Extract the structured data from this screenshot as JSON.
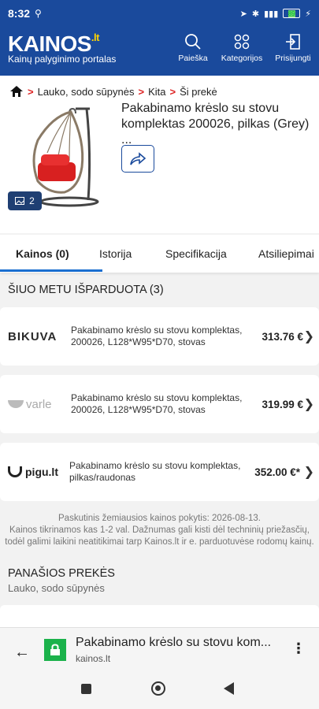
{
  "status": {
    "time": "8:32",
    "battery": "89"
  },
  "header": {
    "logo": "KAINOS",
    "logo_tld": ".lt",
    "tagline": "Kainų palyginimo portalas",
    "nav": [
      {
        "label": "Paieška",
        "icon": "search-icon"
      },
      {
        "label": "Kategorijos",
        "icon": "grid-icon"
      },
      {
        "label": "Prisijungti",
        "icon": "login-icon"
      }
    ]
  },
  "breadcrumb": [
    "Lauko, sodo sūpynės",
    "Kita",
    "Ši prekė"
  ],
  "product": {
    "title": "Pakabinamo krėslo su stovu komplektas 200026, pilkas (Grey) ...",
    "image_count": "2"
  },
  "tabs": [
    "Kainos (0)",
    "Istorija",
    "Specifikacija",
    "Atsiliepimai"
  ],
  "sold_out": {
    "title": "ŠIUO METU IŠPARDUOTA (3)",
    "offers": [
      {
        "shop": "BIKUVA",
        "desc": "Pakabinamo krėslo su stovu komplektas, 200026, L128*W95*D70, stovas",
        "price": "313.76 €"
      },
      {
        "shop": "varle",
        "desc": "Pakabinamo krėslo su stovu komplektas, 200026, L128*W95*D70, stovas",
        "price": "319.99 €"
      },
      {
        "shop": "pigu.lt",
        "desc": "Pakabinamo krėslo su stovu komplektas, pilkas/raudonas",
        "price": "352.00 €*"
      }
    ]
  },
  "note": {
    "line1": "Paskutinis žemiausios kainos pokytis: 2026-08-13.",
    "line2": "Kainos tikrinamos kas 1-2 val. Dažnumas gali kisti dėl techninių priežasčių,",
    "line3": "todėl galimi laikini neatitikimai tarp Kainos.lt ir e. parduotuvėse rodomų kainų."
  },
  "similar": {
    "title": "PANAŠIOS PREKĖS",
    "subtitle": "Lauko, sodo sūpynės"
  },
  "browser": {
    "title": "Pakabinamo krėslo su stovu kom...",
    "url": "kainos.lt"
  }
}
